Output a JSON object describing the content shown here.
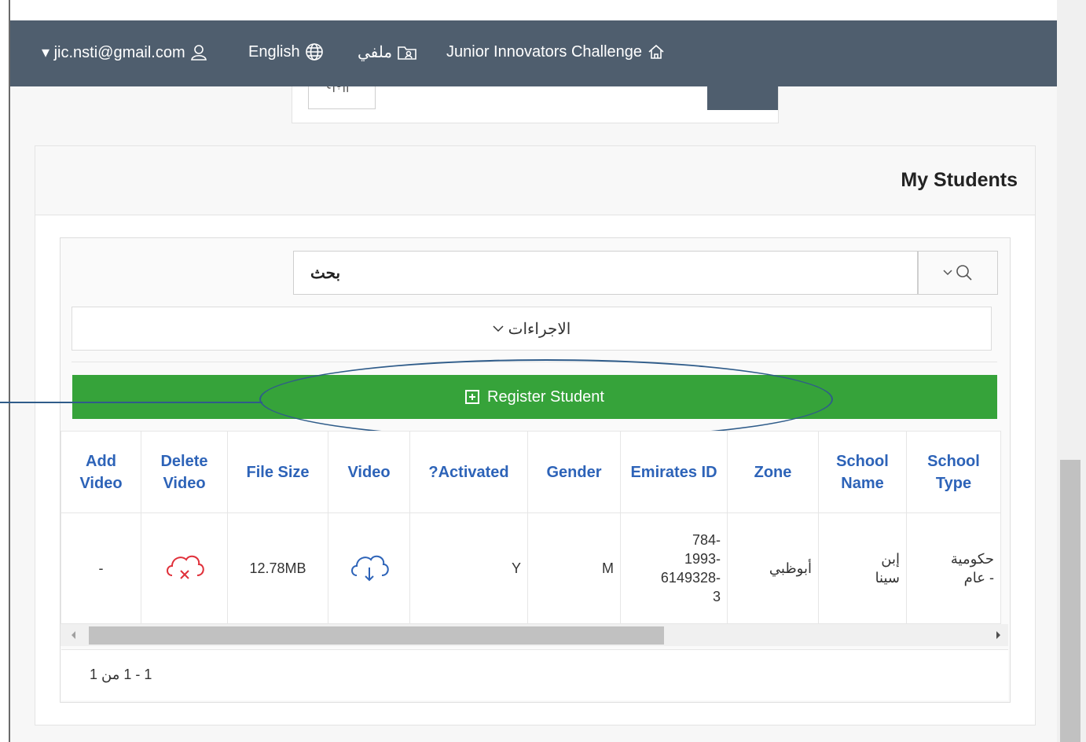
{
  "topbar": {
    "user_email": "▾ jic.nsti@gmail.com",
    "language": "English",
    "profile": "ملفي",
    "app_name": "Junior Innovators Challenge"
  },
  "previous_card": {
    "cancel_label": "إلغاء"
  },
  "region": {
    "title": "My Students"
  },
  "search": {
    "button_label": "بحث",
    "input_value": ""
  },
  "actions_label": "الاجراءات",
  "register_button": "Register Student",
  "table": {
    "headers": [
      "Add Video",
      "Delete Video",
      "File Size",
      "Video",
      "?Activated",
      "Gender",
      "Emirates ID",
      "Zone",
      "School Name",
      "School Type"
    ],
    "rows": [
      {
        "add_video": "-",
        "delete_video_icon": "cloud-delete-icon",
        "file_size": "12.78MB",
        "video_icon": "cloud-download-icon",
        "activated": "Y",
        "gender": "M",
        "emirates_id_lines": [
          "784-",
          "1993-",
          "6149328-",
          "3"
        ],
        "zone": "أبوظبي",
        "school_name_lines": [
          "إبن",
          "سينا"
        ],
        "school_type_lines": [
          "حكومية",
          "- عام"
        ]
      }
    ]
  },
  "pagination": "1 - 1 من 1",
  "colors": {
    "topbar": "#4f5e6e",
    "register_button": "#36a33a",
    "header_text": "#2d63b8",
    "delete_icon": "#e0303a",
    "download_icon": "#2d63b8",
    "annotation": "#2f5c8a"
  }
}
